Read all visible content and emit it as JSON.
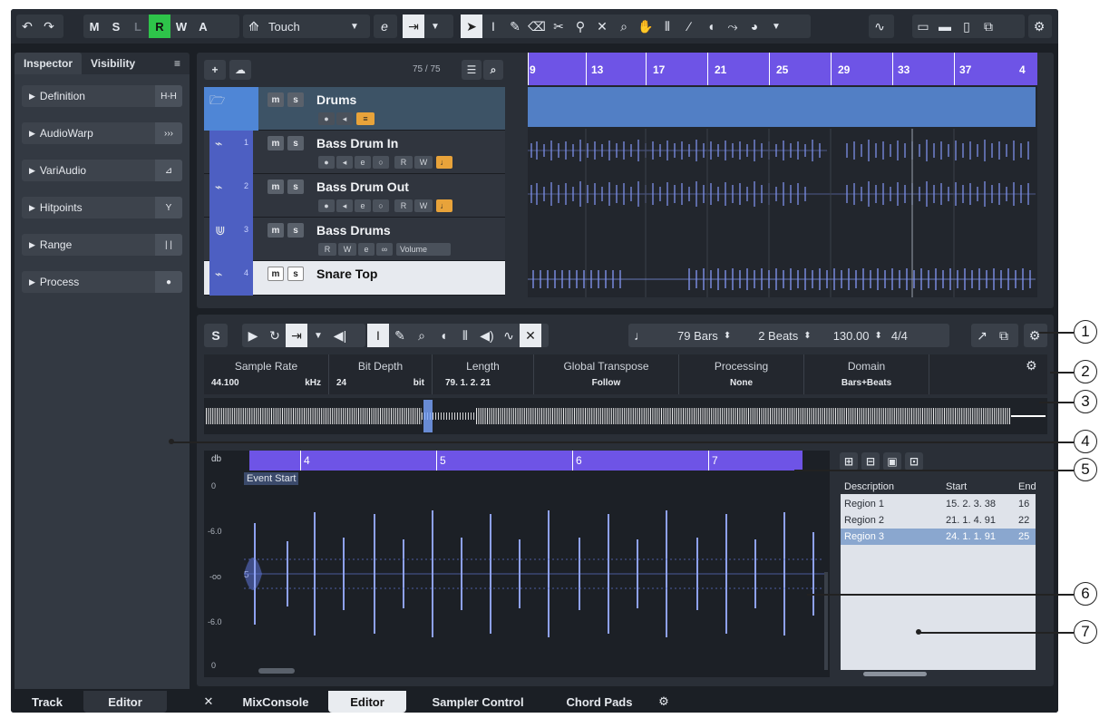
{
  "toolbar": {
    "modes": [
      "M",
      "S",
      "L",
      "R",
      "W",
      "A"
    ],
    "automation_mode": "Touch",
    "e_label": "e"
  },
  "inspector": {
    "tabs": [
      "Inspector",
      "Visibility"
    ],
    "menu_icon": "≡",
    "sections": [
      {
        "label": "Definition",
        "icon": "H-H"
      },
      {
        "label": "AudioWarp",
        "icon": "›››"
      },
      {
        "label": "VariAudio",
        "icon": "⊿"
      },
      {
        "label": "Hitpoints",
        "icon": "Y"
      },
      {
        "label": "Range",
        "icon": "| |"
      },
      {
        "label": "Process",
        "icon": "●"
      }
    ]
  },
  "project": {
    "track_count": "75 / 75",
    "ruler_marks": [
      "9",
      "13",
      "17",
      "21",
      "25",
      "29",
      "33",
      "37",
      "4"
    ],
    "tracks": [
      {
        "num": "",
        "name": "Drums",
        "type": "folder"
      },
      {
        "num": "1",
        "name": "Bass Drum In",
        "type": "audio"
      },
      {
        "num": "2",
        "name": "Bass Drum Out",
        "type": "audio"
      },
      {
        "num": "3",
        "name": "Bass Drums",
        "type": "group",
        "extra": "Volume"
      },
      {
        "num": "4",
        "name": "Snare Top",
        "type": "audio"
      }
    ],
    "ms": [
      "m",
      "s"
    ],
    "rw": [
      "R",
      "W"
    ]
  },
  "editor": {
    "solo_label": "S",
    "bars": "79 Bars",
    "beats": "2 Beats",
    "tempo": "130.00",
    "signature": "4/4",
    "info": [
      {
        "label": "Sample Rate",
        "value": "44.100",
        "unit": "kHz"
      },
      {
        "label": "Bit Depth",
        "value": "24",
        "unit": "bit"
      },
      {
        "label": "Length",
        "value": "79. 1. 2. 21",
        "unit": ""
      },
      {
        "label": "Global Transpose",
        "value": "Follow",
        "unit": ""
      },
      {
        "label": "Processing",
        "value": "None",
        "unit": ""
      },
      {
        "label": "Domain",
        "value": "Bars+Beats",
        "unit": ""
      }
    ],
    "ruler_marks": [
      "4",
      "5",
      "6",
      "7"
    ],
    "db_label": "db",
    "db_scale": [
      "0",
      "-6.0",
      "-oo",
      "-6.0",
      "0"
    ],
    "event_start": "Event Start",
    "marker_5": "5",
    "regions": {
      "headers": [
        "Description",
        "Start",
        "End"
      ],
      "rows": [
        {
          "description": "Region 1",
          "start": "15. 2. 3. 38",
          "end": "16"
        },
        {
          "description": "Region 2",
          "start": "21. 1. 4. 91",
          "end": "22"
        },
        {
          "description": "Region 3",
          "start": "24. 1. 1. 91",
          "end": "25"
        }
      ]
    }
  },
  "bottom_tabs": {
    "left": [
      "Track",
      "Editor"
    ],
    "close": "✕",
    "lower_zone": [
      "MixConsole",
      "Editor",
      "Sampler Control",
      "Chord Pads"
    ]
  },
  "callouts": [
    "1",
    "2",
    "3",
    "4",
    "5",
    "6",
    "7"
  ],
  "colors": {
    "accent": "#6e54e6",
    "track_blue": "#4d5fc2",
    "record_green": "#2ec44a",
    "wave": "#7d90e8",
    "marker_orange": "#e8a33a"
  }
}
